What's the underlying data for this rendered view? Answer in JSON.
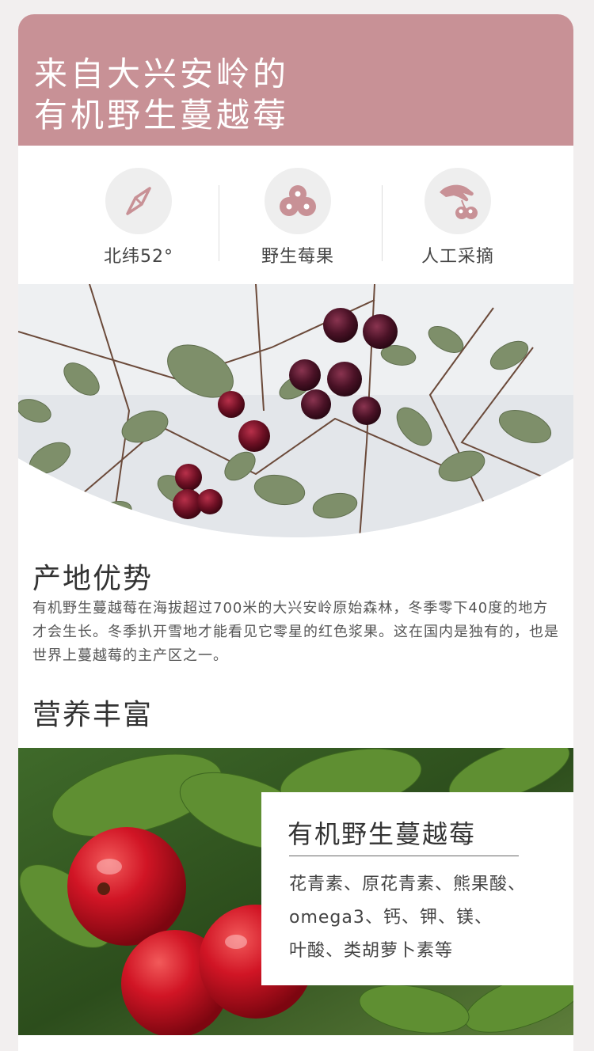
{
  "hero": {
    "title_line1": "来自大兴安岭的",
    "title_line2": "有机野生蔓越莓",
    "color": "#c89196"
  },
  "features": [
    {
      "icon": "compass-icon",
      "label": "北纬52°"
    },
    {
      "icon": "berries-icon",
      "label": "野生莓果"
    },
    {
      "icon": "hand-picking-icon",
      "label": "人工采摘"
    }
  ],
  "origin": {
    "title": "产地优势",
    "body": "有机野生蔓越莓在海拔超过700米的大兴安岭原始森林，冬季零下40度的地方才会生长。冬季扒开雪地才能看见它零星的红色浆果。这在国内是独有的，也是世界上蔓越莓的主产区之一。"
  },
  "nutrition": {
    "title": "营养丰富",
    "box_title": "有机野生蔓越莓",
    "line1": "花青素、原花青素、熊果酸、",
    "line2": "omega3、钙、钾、镁、",
    "line3": "叶酸、类胡萝卜素等"
  }
}
